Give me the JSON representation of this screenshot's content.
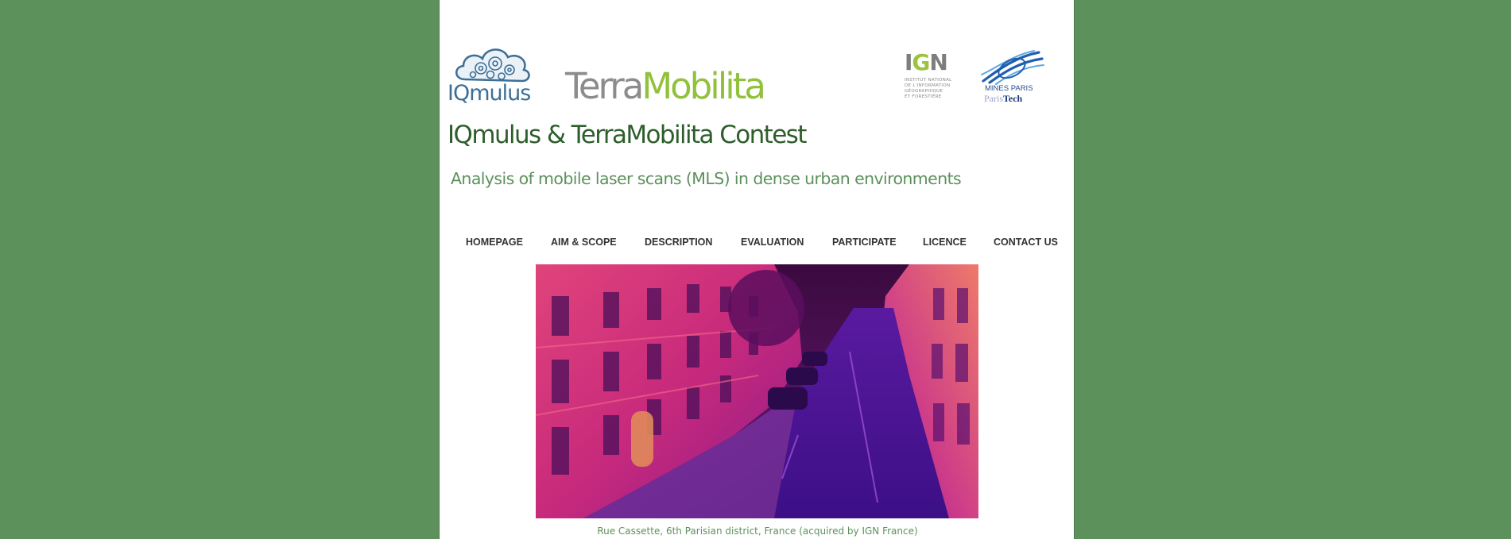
{
  "colors": {
    "background": "#5d915c",
    "page": "#ffffff",
    "title": "#2e5e2c",
    "subtitle": "#5d915c",
    "nav_text": "#333333",
    "iqmulus_blue": "#3d6f96",
    "terramobilita_grey": "#8c8c8c",
    "terramobilita_green": "#92c13e",
    "mines_blue": "#2a4f93"
  },
  "logos": {
    "iqmulus": {
      "text": "IQmulus",
      "icon": "cloud-gears-icon"
    },
    "terramobilita": {
      "part1": "Terra",
      "part2": "Mobilita"
    },
    "ign": {
      "letters": [
        "I",
        "G",
        "N"
      ],
      "lines": [
        "INSTITUT NATIONAL",
        "DE L'INFORMATION",
        "GÉOGRAPHIQUE",
        "ET FORESTIÈRE"
      ]
    },
    "mines": {
      "line1": "MINES PARIS",
      "line2_a": "Paris",
      "line2_b": "Tech",
      "icon": "mines-swoosh-icon"
    }
  },
  "header": {
    "title": "IQmulus & TerraMobilita Contest",
    "subtitle": "Analysis of mobile laser scans (MLS) in dense urban environments"
  },
  "nav": {
    "items": [
      {
        "label": "HOMEPAGE"
      },
      {
        "label": "AIM & SCOPE"
      },
      {
        "label": "DESCRIPTION"
      },
      {
        "label": "EVALUATION"
      },
      {
        "label": "PARTICIPATE"
      },
      {
        "label": "LICENCE"
      },
      {
        "label": "CONTACT US"
      }
    ]
  },
  "hero": {
    "caption": "Rue Cassette, 6th Parisian district, France (acquired by IGN France)"
  }
}
